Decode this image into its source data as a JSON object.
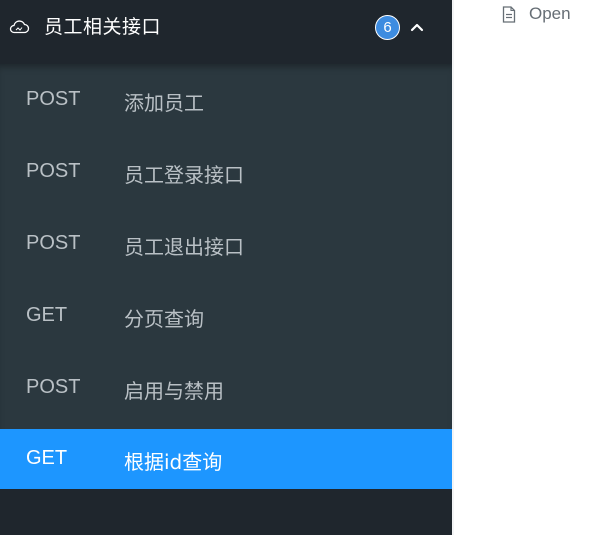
{
  "sidebar": {
    "group": {
      "icon": "cloud-icon",
      "title": "员工相关接口",
      "count": "6",
      "toggle_icon": "chevron-up-icon"
    },
    "items": [
      {
        "method": "POST",
        "label": "添加员工",
        "selected": false
      },
      {
        "method": "POST",
        "label": "员工登录接口",
        "selected": false
      },
      {
        "method": "POST",
        "label": "员工退出接口",
        "selected": false
      },
      {
        "method": "GET",
        "label": "分页查询",
        "selected": false
      },
      {
        "method": "POST",
        "label": "启用与禁用",
        "selected": false
      },
      {
        "method": "GET",
        "label": "根据id查询",
        "selected": true
      }
    ]
  },
  "main": {
    "open_link": {
      "icon": "document-icon",
      "label": "Open"
    }
  },
  "colors": {
    "sidebar_bg": "#1f262d",
    "list_bg": "#2b383f",
    "selected_bg": "#1d96ff",
    "badge_bg": "#3d8ce0",
    "text_muted": "#b9c0c5"
  }
}
